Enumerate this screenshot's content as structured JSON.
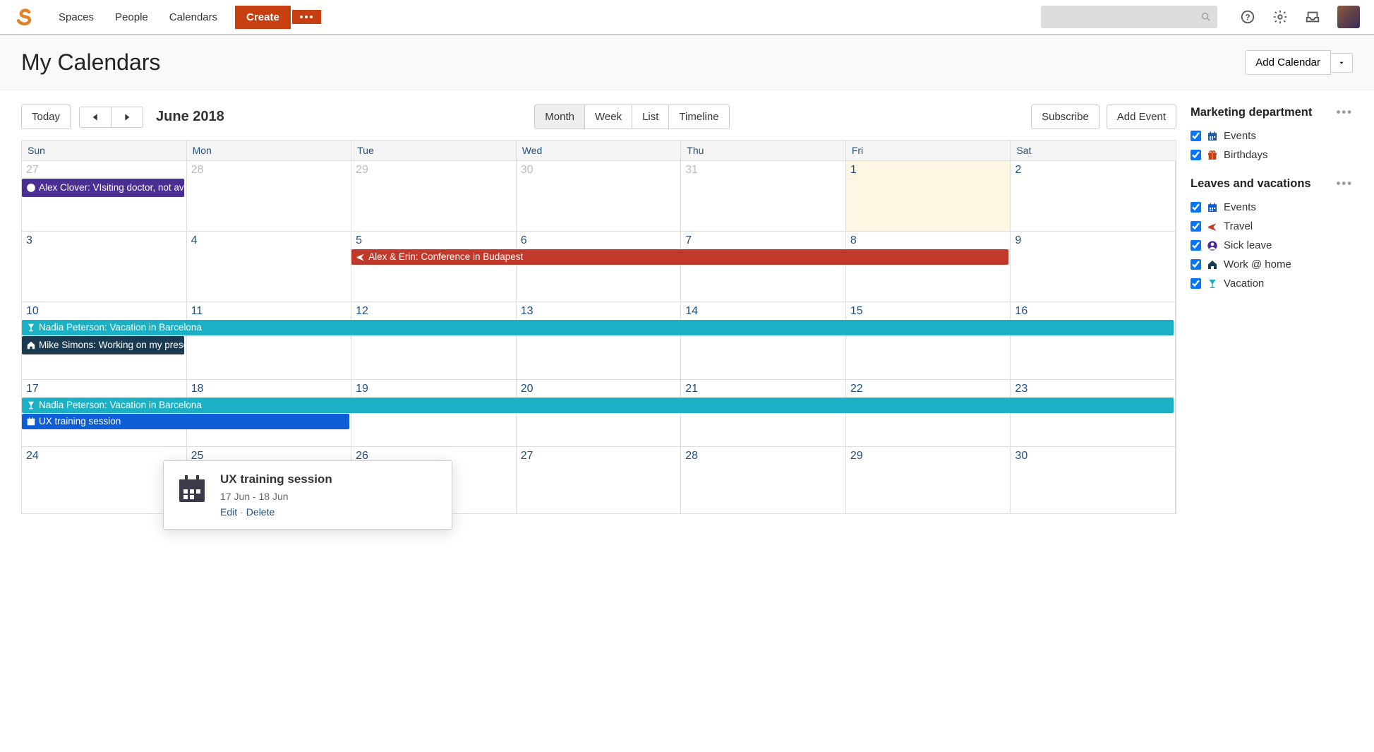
{
  "nav": {
    "items": [
      "Spaces",
      "People",
      "Calendars"
    ],
    "create": "Create",
    "search_placeholder": ""
  },
  "page": {
    "title": "My Calendars",
    "add_calendar": "Add Calendar"
  },
  "toolbar": {
    "today": "Today",
    "month_label": "June 2018",
    "views": [
      "Month",
      "Week",
      "List",
      "Timeline"
    ],
    "active_view": 0,
    "subscribe": "Subscribe",
    "add_event": "Add Event"
  },
  "days": [
    "Sun",
    "Mon",
    "Tue",
    "Wed",
    "Thu",
    "Fri",
    "Sat"
  ],
  "weeks": [
    [
      {
        "n": "27",
        "muted": true
      },
      {
        "n": "28",
        "muted": true
      },
      {
        "n": "29",
        "muted": true
      },
      {
        "n": "30",
        "muted": true
      },
      {
        "n": "31",
        "muted": true
      },
      {
        "n": "1",
        "today": true
      },
      {
        "n": "2"
      }
    ],
    [
      {
        "n": "3"
      },
      {
        "n": "4"
      },
      {
        "n": "5"
      },
      {
        "n": "6"
      },
      {
        "n": "7"
      },
      {
        "n": "8"
      },
      {
        "n": "9"
      }
    ],
    [
      {
        "n": "10"
      },
      {
        "n": "11"
      },
      {
        "n": "12"
      },
      {
        "n": "13"
      },
      {
        "n": "14"
      },
      {
        "n": "15"
      },
      {
        "n": "16"
      }
    ],
    [
      {
        "n": "17"
      },
      {
        "n": "18"
      },
      {
        "n": "19"
      },
      {
        "n": "20"
      },
      {
        "n": "21"
      },
      {
        "n": "22"
      },
      {
        "n": "23"
      }
    ],
    [
      {
        "n": "24"
      },
      {
        "n": "25"
      },
      {
        "n": "26"
      },
      {
        "n": "27"
      },
      {
        "n": "28"
      },
      {
        "n": "29"
      },
      {
        "n": "30"
      }
    ]
  ],
  "events": {
    "sick": "Alex Clover: VIsiting doctor, not available",
    "conf": "Alex & Erin: Conference in Budapest",
    "vacation": "Nadia Peterson: Vacation in Barcelona",
    "wfh": "Mike Simons: Working on my presentation",
    "ux": "UX training session"
  },
  "popover": {
    "title": "UX training session",
    "date": "17 Jun - 18 Jun",
    "edit": "Edit",
    "delete": "Delete"
  },
  "sidebar": {
    "groups": [
      {
        "title": "Marketing department",
        "items": [
          {
            "label": "Events",
            "icon": "calendar",
            "color": "#205a9c"
          },
          {
            "label": "Birthdays",
            "icon": "gift",
            "color": "#c73e11"
          }
        ]
      },
      {
        "title": "Leaves and vacations",
        "items": [
          {
            "label": "Events",
            "icon": "calendar",
            "color": "#0d5ed7"
          },
          {
            "label": "Travel",
            "icon": "plane",
            "color": "#c1392b"
          },
          {
            "label": "Sick leave",
            "icon": "user",
            "color": "#4b2e91"
          },
          {
            "label": "Work @ home",
            "icon": "home",
            "color": "#1a3a52"
          },
          {
            "label": "Vacation",
            "icon": "glass",
            "color": "#1bb0c4"
          }
        ]
      }
    ]
  }
}
